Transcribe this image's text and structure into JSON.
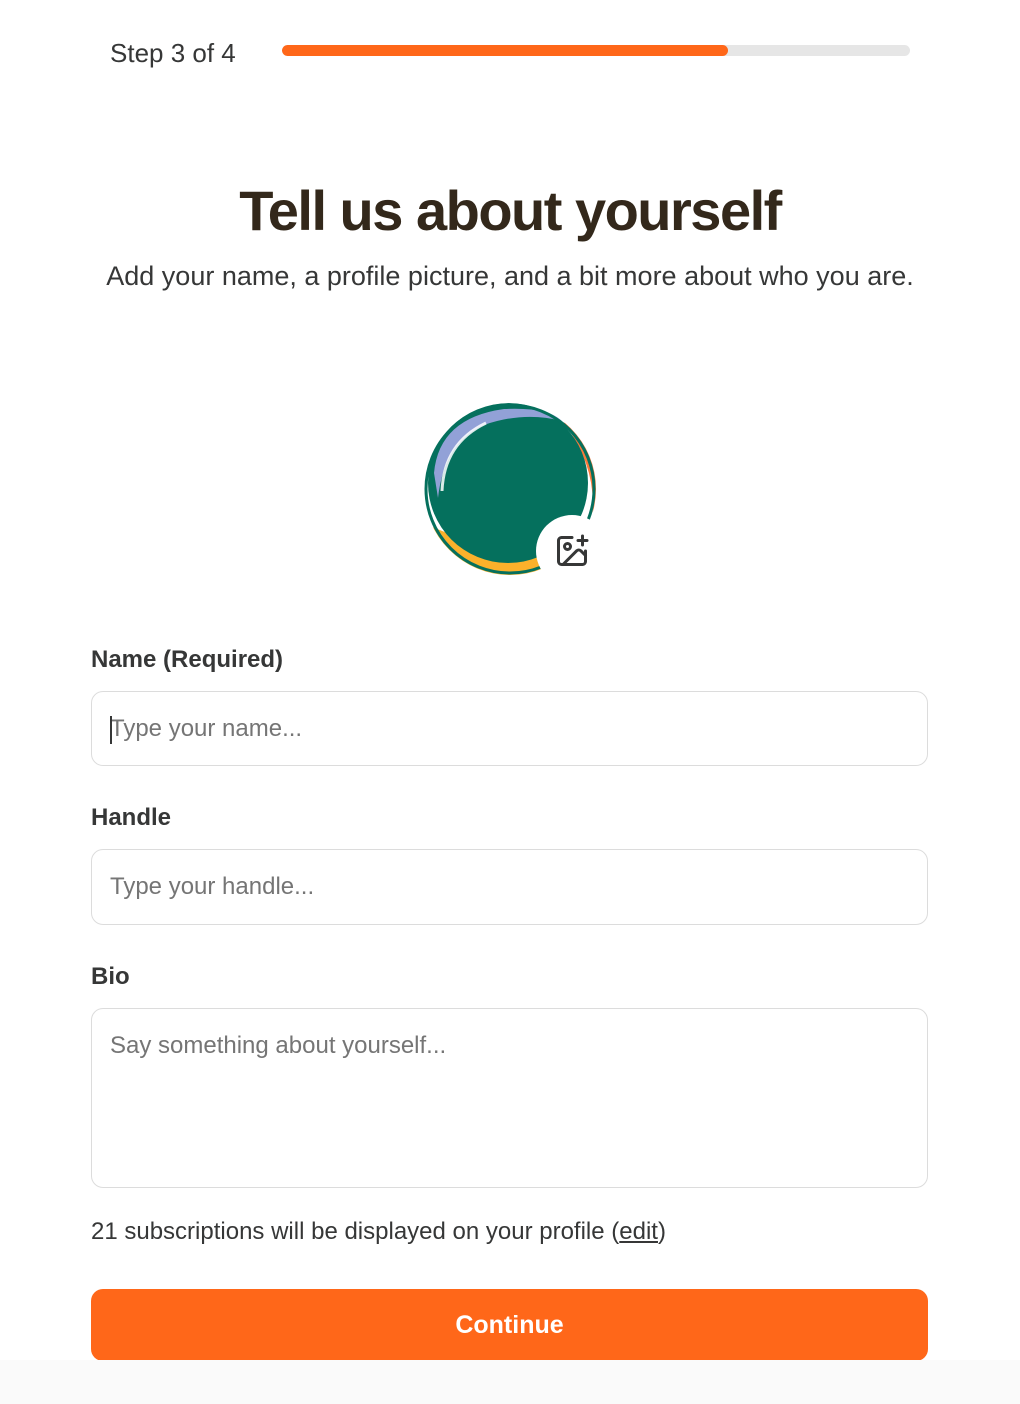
{
  "progress": {
    "label": "Step 3 of 4",
    "current_step": 3,
    "total_steps": 4,
    "fill_fraction": 0.71
  },
  "header": {
    "title": "Tell us about yourself",
    "subtitle": "Add your name, a profile picture, and a bit more about who you are."
  },
  "avatar": {
    "upload_icon": "image-add-icon",
    "colors": {
      "main": "#05705d",
      "top_highlight": "#9aa3dd",
      "bottom": "#fbb12b",
      "right": "#fa7a3b",
      "shadow": "#2b2320"
    }
  },
  "form": {
    "name": {
      "label": "Name (Required)",
      "placeholder": "Type your name...",
      "value": ""
    },
    "handle": {
      "label": "Handle",
      "placeholder": "Type your handle...",
      "value": ""
    },
    "bio": {
      "label": "Bio",
      "placeholder": "Say something about yourself...",
      "value": ""
    }
  },
  "subscriptions_note": {
    "text": "21 subscriptions will be displayed on your profile (",
    "link": "edit",
    "suffix": ")"
  },
  "continue_button": {
    "label": "Continue"
  },
  "colors": {
    "accent": "#ff6719",
    "track": "#e6e6e6",
    "title": "#33281b",
    "text": "#363737"
  }
}
